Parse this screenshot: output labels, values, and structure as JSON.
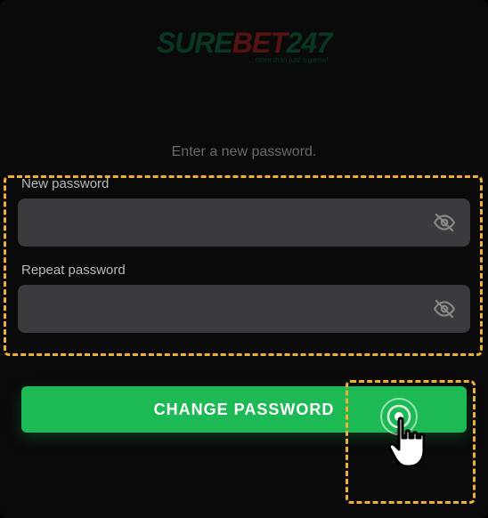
{
  "logo": {
    "part1": "SURE",
    "part2": "BET",
    "part3": "247",
    "tagline": "...more than just a game!"
  },
  "instruction_text": "Enter a new password.",
  "fields": {
    "new_password": {
      "label": "New password",
      "value": ""
    },
    "repeat_password": {
      "label": "Repeat password",
      "value": ""
    }
  },
  "button_label": "CHANGE PASSWORD",
  "colors": {
    "accent": "#1db954",
    "highlight": "#f0b030"
  }
}
